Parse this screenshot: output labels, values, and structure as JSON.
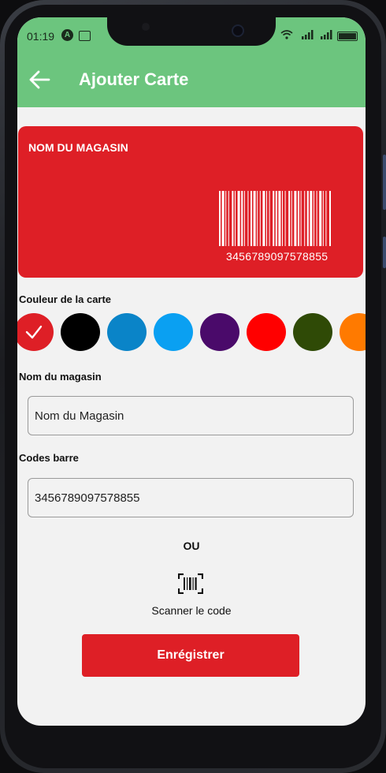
{
  "status": {
    "time": "01:19"
  },
  "appbar": {
    "title": "Ajouter Carte"
  },
  "card": {
    "store_name": "NOM DU MAGASIN",
    "barcode_number": "3456789097578855",
    "color": "#de1f26"
  },
  "color_section": {
    "label": "Couleur de la carte",
    "selected_index": 0,
    "colors": [
      "#de1f26",
      "#000000",
      "#0a84c8",
      "#0aa0f2",
      "#4a0a6a",
      "#ff0000",
      "#2f4a06",
      "#ff7a00"
    ]
  },
  "store_field": {
    "label": "Nom du magasin",
    "value": "Nom du Magasin"
  },
  "barcode_field": {
    "label": "Codes barre",
    "value": "3456789097578855"
  },
  "divider_text": "OU",
  "scan": {
    "label": "Scanner le code",
    "icon": "barcode-scan-icon"
  },
  "save_button": {
    "label": "Enrégistrer"
  }
}
